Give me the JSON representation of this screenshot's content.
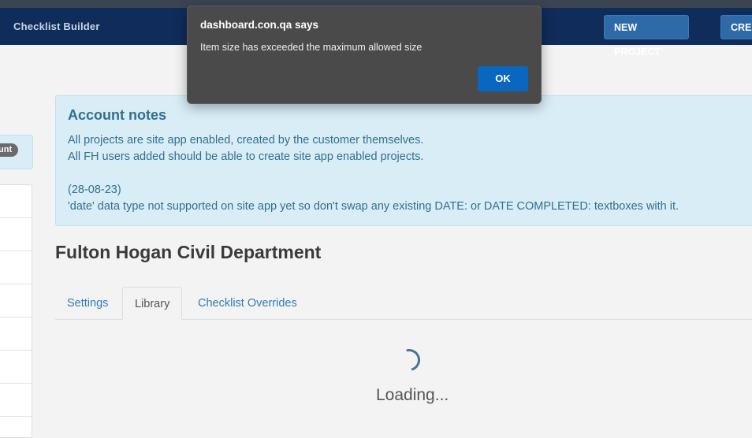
{
  "navbar": {
    "brand": "Checklist Builder",
    "new_project_label": "NEW PROJECT",
    "create_label": "CREA"
  },
  "sidebar": {
    "badge_text": "unt"
  },
  "account_notes": {
    "title": "Account notes",
    "lines": [
      "All projects are site app enabled, created by the customer themselves.",
      "All FH users added should be able to create site app enabled projects.",
      "(28-08-23)",
      "'date' data type not supported on site app yet so don't swap any existing DATE: or DATE COMPLETED: textboxes with it."
    ]
  },
  "project": {
    "title": "Fulton Hogan Civil Department"
  },
  "tabs": [
    {
      "label": "Settings"
    },
    {
      "label": "Library"
    },
    {
      "label": "Checklist Overrides"
    }
  ],
  "loading_text": "Loading...",
  "dialog": {
    "title": "dashboard.con.qa says",
    "message": "Item size has exceeded the maximum allowed size",
    "ok_label": "OK"
  },
  "colors": {
    "navbar": "#0f2c5a",
    "button": "#2f6aa8",
    "alert_bg": "#d9edf7",
    "alert_text": "#31708f",
    "dialog_bg": "#4a4a4a",
    "ok_button": "#0a67c0"
  }
}
